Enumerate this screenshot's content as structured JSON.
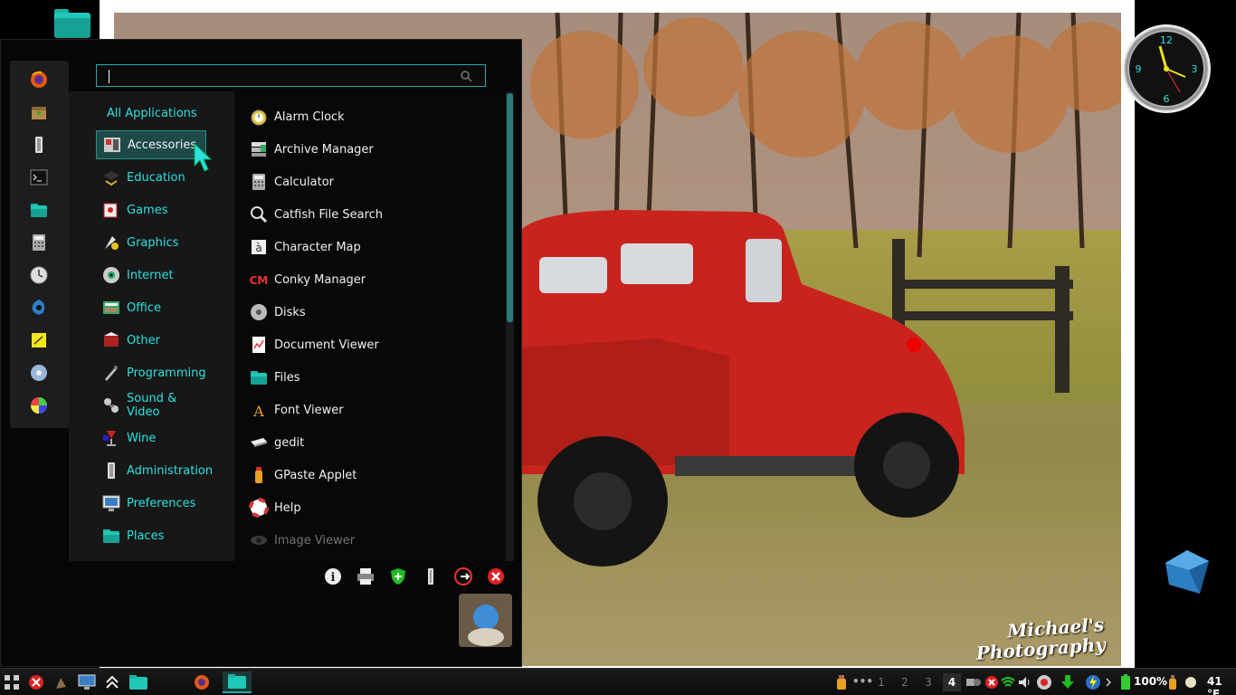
{
  "colors": {
    "accent": "#2ee0e0",
    "menu_bg": "#070707",
    "panel_bg": "#171717",
    "selected_bg": "#1d4a48"
  },
  "wallpaper": {
    "watermark_line1": "Michael's",
    "watermark_line2": "Photography"
  },
  "menu": {
    "search": {
      "value": "",
      "placeholder": ""
    },
    "favorites": [
      "firefox-icon",
      "package-icon",
      "system-settings-icon",
      "terminal-icon",
      "files-icon",
      "calculator-icon",
      "clock-icon",
      "shotwell-icon",
      "sticky-notes-icon",
      "disk-icon",
      "color-picker-icon"
    ],
    "all_applications": "All Applications",
    "categories": [
      {
        "label": "Accessories",
        "icon": "accessories-icon",
        "selected": true
      },
      {
        "label": "Education",
        "icon": "education-icon"
      },
      {
        "label": "Games",
        "icon": "games-icon"
      },
      {
        "label": "Graphics",
        "icon": "graphics-icon"
      },
      {
        "label": "Internet",
        "icon": "internet-icon"
      },
      {
        "label": "Office",
        "icon": "office-icon"
      },
      {
        "label": "Other",
        "icon": "other-icon"
      },
      {
        "label": "Programming",
        "icon": "programming-icon"
      },
      {
        "label": "Sound & Video",
        "icon": "sound-video-icon"
      },
      {
        "label": "Wine",
        "icon": "wine-icon"
      },
      {
        "label": "Administration",
        "icon": "administration-icon"
      },
      {
        "label": "Preferences",
        "icon": "preferences-icon"
      },
      {
        "label": "Places",
        "icon": "places-icon"
      }
    ],
    "apps": [
      {
        "label": "Alarm Clock",
        "icon": "alarm-clock-icon"
      },
      {
        "label": "Archive Manager",
        "icon": "archive-manager-icon"
      },
      {
        "label": "Calculator",
        "icon": "calculator-icon"
      },
      {
        "label": "Catfish File Search",
        "icon": "catfish-search-icon"
      },
      {
        "label": "Character Map",
        "icon": "character-map-icon"
      },
      {
        "label": "Conky Manager",
        "icon": "conky-manager-icon"
      },
      {
        "label": "Disks",
        "icon": "disks-icon"
      },
      {
        "label": "Document Viewer",
        "icon": "document-viewer-icon"
      },
      {
        "label": "Files",
        "icon": "files-icon"
      },
      {
        "label": "Font Viewer",
        "icon": "font-viewer-icon"
      },
      {
        "label": "gedit",
        "icon": "gedit-icon"
      },
      {
        "label": "GPaste Applet",
        "icon": "gpaste-icon"
      },
      {
        "label": "Help",
        "icon": "help-icon"
      },
      {
        "label": "Image Viewer",
        "icon": "image-viewer-icon",
        "faded": true
      }
    ],
    "system_buttons": [
      "about-icon",
      "printer-icon",
      "shield-icon",
      "settings-icon",
      "logout-icon",
      "quit-icon"
    ]
  },
  "taskbar": {
    "workspaces": [
      "1",
      "2",
      "3",
      "4"
    ],
    "active_workspace": "4",
    "ellipsis": "•••",
    "battery": "100%",
    "temperature": "41 °F"
  }
}
